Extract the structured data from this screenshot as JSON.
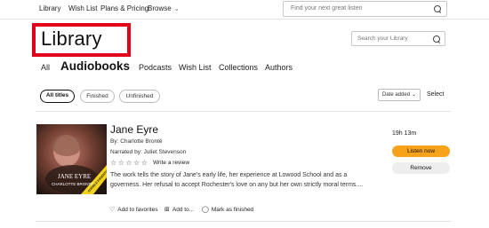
{
  "topnav": {
    "items": [
      "Library",
      "Wish List",
      "Plans & Pricing",
      "Browse"
    ],
    "browse_chevron_icon": "chevron-down-icon",
    "search_placeholder": "Find your next great listen"
  },
  "page": {
    "title": "Library",
    "search_placeholder": "Search your Library",
    "highlight_color": "#e3001b"
  },
  "tabs": [
    "All",
    "Audiobooks",
    "Podcasts",
    "Wish List",
    "Collections",
    "Authors"
  ],
  "active_tab": "Audiobooks",
  "filters": {
    "chips": [
      "All titles",
      "Finished",
      "Unfinished"
    ],
    "active_chip": "All titles",
    "sort_value": "Date added",
    "select_label": "Select"
  },
  "item": {
    "title": "Jane Eyre",
    "author": "By: Charlotte Brontë",
    "narrator": "Narrated by: Juliet Stevenson",
    "stars": "☆☆☆☆☆",
    "rating_out_of_5": 0,
    "write_review": "Write a review",
    "description": "The work tells the story of Jane's early life, her experience at Lowood School and as a governess. Her refusal to accept Rochester's love on any but her own strictly moral terms....",
    "cover": {
      "title": "JANE EYRE",
      "author": "CHARLOTTE BRONTË",
      "banner": "AUDIBLE ESSENTIALS"
    },
    "actions": {
      "favorites": "Add to favorites",
      "add_to": "Add to...",
      "mark_finished": "Mark as finished"
    },
    "duration": "19h 13m",
    "listen_label": "Listen now",
    "remove_label": "Remove",
    "listen_color": "#f7a21b"
  }
}
